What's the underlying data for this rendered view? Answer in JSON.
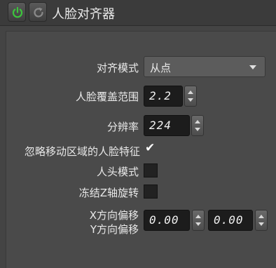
{
  "header": {
    "title": "人脸对齐器",
    "power_color": "#3cc63c"
  },
  "form": {
    "align_mode": {
      "label": "对齐模式",
      "value": "从点"
    },
    "face_coverage": {
      "label": "人脸覆盖范围",
      "value": "2.2"
    },
    "resolution": {
      "label": "分辨率",
      "value": "224"
    },
    "ignore_moving": {
      "label": "忽略移动区域的人脸特征",
      "checked": true
    },
    "head_mode": {
      "label": "人头模式",
      "checked": false
    },
    "freeze_z": {
      "label": "冻结Z轴旋转",
      "checked": false
    },
    "x_offset": {
      "label": "X方向偏移",
      "value": "0.00"
    },
    "y_offset": {
      "label": "Y方向偏移",
      "value": "0.00"
    }
  },
  "icons": {
    "power": "power-icon",
    "refresh": "refresh-icon",
    "check": "check-icon",
    "dropdown": "chevron-down-icon"
  }
}
